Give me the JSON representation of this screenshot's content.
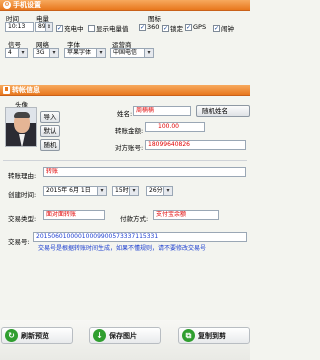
{
  "phone_settings": {
    "header": "手机设置",
    "time_label": "时间",
    "time_value": "10:13",
    "battery_label": "电量",
    "battery_value": "89",
    "charging_label": "充电中",
    "show_battery_label": "显示电量值",
    "icons_label": "图标",
    "icon_360": "360",
    "icon_lock": "锁定",
    "icon_gps": "GPS",
    "icon_alarm": "闹钟",
    "signal_label": "信号",
    "signal_value": "4",
    "network_label": "网络",
    "network_value": "3G",
    "font_label": "字体",
    "font_value": "苹果字体",
    "carrier_label": "运营商",
    "carrier_value": "中国电信"
  },
  "transfer_info": {
    "header": "转帐信息",
    "avatar_label": "头像",
    "import_button": "导入",
    "default_button": "默认",
    "random_button": "随机",
    "name_label": "姓名:",
    "name_value": "周楠楠",
    "random_name_button": "随机姓名",
    "amount_label": "转账金额:",
    "amount_value": "100.00",
    "account_label": "对方账号:",
    "account_value": "18099640826",
    "reason_label": "转账理由:",
    "reason_value": "转账",
    "created_label": "创建时间:",
    "date_value": "2015年 6月 1日",
    "hour_value": "15时",
    "minute_value": "26分",
    "trade_type_label": "交易类型:",
    "trade_type_value": "面对面转账",
    "pay_method_label": "付款方式:",
    "pay_method_value": "支付宝余额",
    "trade_no_label": "交易号:",
    "trade_no_value": "2015060100001000990057333711533​1",
    "trade_no_note": "交易号是根据转账时间生成，如果不懂规则，请不要修改交易号"
  },
  "actions": {
    "refresh_label": "刷新预览",
    "save_label": "保存图片",
    "copy_label": "复制到剪"
  }
}
